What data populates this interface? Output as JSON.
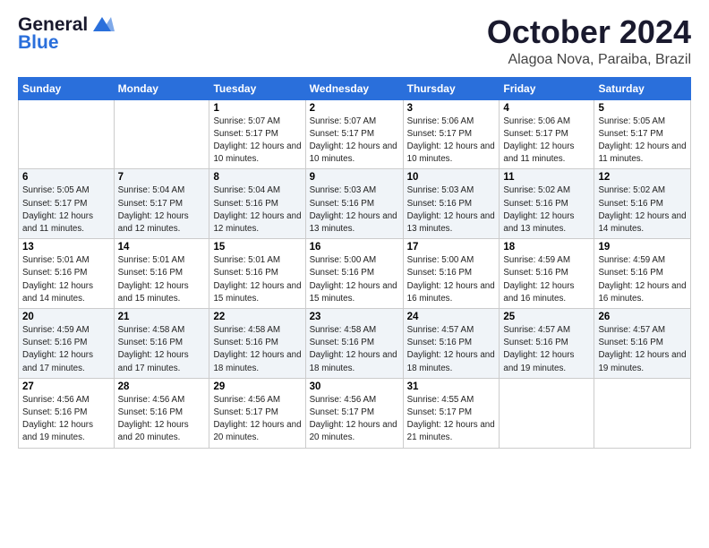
{
  "logo": {
    "line1": "General",
    "line2": "Blue"
  },
  "title": "October 2024",
  "location": "Alagoa Nova, Paraiba, Brazil",
  "days_of_week": [
    "Sunday",
    "Monday",
    "Tuesday",
    "Wednesday",
    "Thursday",
    "Friday",
    "Saturday"
  ],
  "weeks": [
    [
      {
        "day": "",
        "info": ""
      },
      {
        "day": "",
        "info": ""
      },
      {
        "day": "1",
        "info": "Sunrise: 5:07 AM\nSunset: 5:17 PM\nDaylight: 12 hours and 10 minutes."
      },
      {
        "day": "2",
        "info": "Sunrise: 5:07 AM\nSunset: 5:17 PM\nDaylight: 12 hours and 10 minutes."
      },
      {
        "day": "3",
        "info": "Sunrise: 5:06 AM\nSunset: 5:17 PM\nDaylight: 12 hours and 10 minutes."
      },
      {
        "day": "4",
        "info": "Sunrise: 5:06 AM\nSunset: 5:17 PM\nDaylight: 12 hours and 11 minutes."
      },
      {
        "day": "5",
        "info": "Sunrise: 5:05 AM\nSunset: 5:17 PM\nDaylight: 12 hours and 11 minutes."
      }
    ],
    [
      {
        "day": "6",
        "info": "Sunrise: 5:05 AM\nSunset: 5:17 PM\nDaylight: 12 hours and 11 minutes."
      },
      {
        "day": "7",
        "info": "Sunrise: 5:04 AM\nSunset: 5:17 PM\nDaylight: 12 hours and 12 minutes."
      },
      {
        "day": "8",
        "info": "Sunrise: 5:04 AM\nSunset: 5:16 PM\nDaylight: 12 hours and 12 minutes."
      },
      {
        "day": "9",
        "info": "Sunrise: 5:03 AM\nSunset: 5:16 PM\nDaylight: 12 hours and 13 minutes."
      },
      {
        "day": "10",
        "info": "Sunrise: 5:03 AM\nSunset: 5:16 PM\nDaylight: 12 hours and 13 minutes."
      },
      {
        "day": "11",
        "info": "Sunrise: 5:02 AM\nSunset: 5:16 PM\nDaylight: 12 hours and 13 minutes."
      },
      {
        "day": "12",
        "info": "Sunrise: 5:02 AM\nSunset: 5:16 PM\nDaylight: 12 hours and 14 minutes."
      }
    ],
    [
      {
        "day": "13",
        "info": "Sunrise: 5:01 AM\nSunset: 5:16 PM\nDaylight: 12 hours and 14 minutes."
      },
      {
        "day": "14",
        "info": "Sunrise: 5:01 AM\nSunset: 5:16 PM\nDaylight: 12 hours and 15 minutes."
      },
      {
        "day": "15",
        "info": "Sunrise: 5:01 AM\nSunset: 5:16 PM\nDaylight: 12 hours and 15 minutes."
      },
      {
        "day": "16",
        "info": "Sunrise: 5:00 AM\nSunset: 5:16 PM\nDaylight: 12 hours and 15 minutes."
      },
      {
        "day": "17",
        "info": "Sunrise: 5:00 AM\nSunset: 5:16 PM\nDaylight: 12 hours and 16 minutes."
      },
      {
        "day": "18",
        "info": "Sunrise: 4:59 AM\nSunset: 5:16 PM\nDaylight: 12 hours and 16 minutes."
      },
      {
        "day": "19",
        "info": "Sunrise: 4:59 AM\nSunset: 5:16 PM\nDaylight: 12 hours and 16 minutes."
      }
    ],
    [
      {
        "day": "20",
        "info": "Sunrise: 4:59 AM\nSunset: 5:16 PM\nDaylight: 12 hours and 17 minutes."
      },
      {
        "day": "21",
        "info": "Sunrise: 4:58 AM\nSunset: 5:16 PM\nDaylight: 12 hours and 17 minutes."
      },
      {
        "day": "22",
        "info": "Sunrise: 4:58 AM\nSunset: 5:16 PM\nDaylight: 12 hours and 18 minutes."
      },
      {
        "day": "23",
        "info": "Sunrise: 4:58 AM\nSunset: 5:16 PM\nDaylight: 12 hours and 18 minutes."
      },
      {
        "day": "24",
        "info": "Sunrise: 4:57 AM\nSunset: 5:16 PM\nDaylight: 12 hours and 18 minutes."
      },
      {
        "day": "25",
        "info": "Sunrise: 4:57 AM\nSunset: 5:16 PM\nDaylight: 12 hours and 19 minutes."
      },
      {
        "day": "26",
        "info": "Sunrise: 4:57 AM\nSunset: 5:16 PM\nDaylight: 12 hours and 19 minutes."
      }
    ],
    [
      {
        "day": "27",
        "info": "Sunrise: 4:56 AM\nSunset: 5:16 PM\nDaylight: 12 hours and 19 minutes."
      },
      {
        "day": "28",
        "info": "Sunrise: 4:56 AM\nSunset: 5:16 PM\nDaylight: 12 hours and 20 minutes."
      },
      {
        "day": "29",
        "info": "Sunrise: 4:56 AM\nSunset: 5:17 PM\nDaylight: 12 hours and 20 minutes."
      },
      {
        "day": "30",
        "info": "Sunrise: 4:56 AM\nSunset: 5:17 PM\nDaylight: 12 hours and 20 minutes."
      },
      {
        "day": "31",
        "info": "Sunrise: 4:55 AM\nSunset: 5:17 PM\nDaylight: 12 hours and 21 minutes."
      },
      {
        "day": "",
        "info": ""
      },
      {
        "day": "",
        "info": ""
      }
    ]
  ]
}
